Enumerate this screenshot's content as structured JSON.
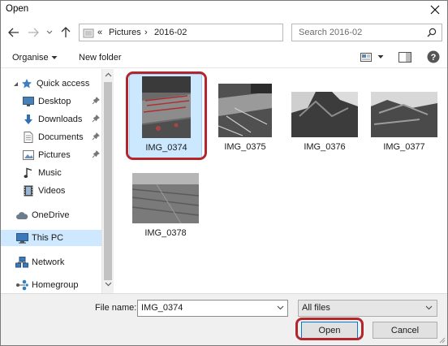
{
  "window": {
    "title": "Open"
  },
  "address": {
    "overflow": "«",
    "crumbs": [
      "Pictures",
      "2016-02"
    ],
    "separator": "›"
  },
  "search": {
    "placeholder": "Search 2016-02"
  },
  "toolbar": {
    "organise_label": "Organise",
    "new_folder_label": "New folder"
  },
  "nav": {
    "quick_access": "Quick access",
    "pinned": [
      "Desktop",
      "Downloads",
      "Documents",
      "Pictures"
    ],
    "other_quick": [
      "Music",
      "Videos"
    ],
    "onedrive": "OneDrive",
    "this_pc": "This PC",
    "network": "Network",
    "homegroup": "Homegroup"
  },
  "files": [
    "IMG_0374",
    "IMG_0375",
    "IMG_0376",
    "IMG_0377",
    "IMG_0378"
  ],
  "selected_file": "IMG_0374",
  "footer": {
    "file_name_label": "File name:",
    "file_name_value": "IMG_0374",
    "filter_value": "All files",
    "open_label": "Open",
    "cancel_label": "Cancel"
  },
  "colors": {
    "selection_bg": "#cce8ff",
    "highlight_ring": "#b3262b",
    "accent": "#0078d7"
  }
}
